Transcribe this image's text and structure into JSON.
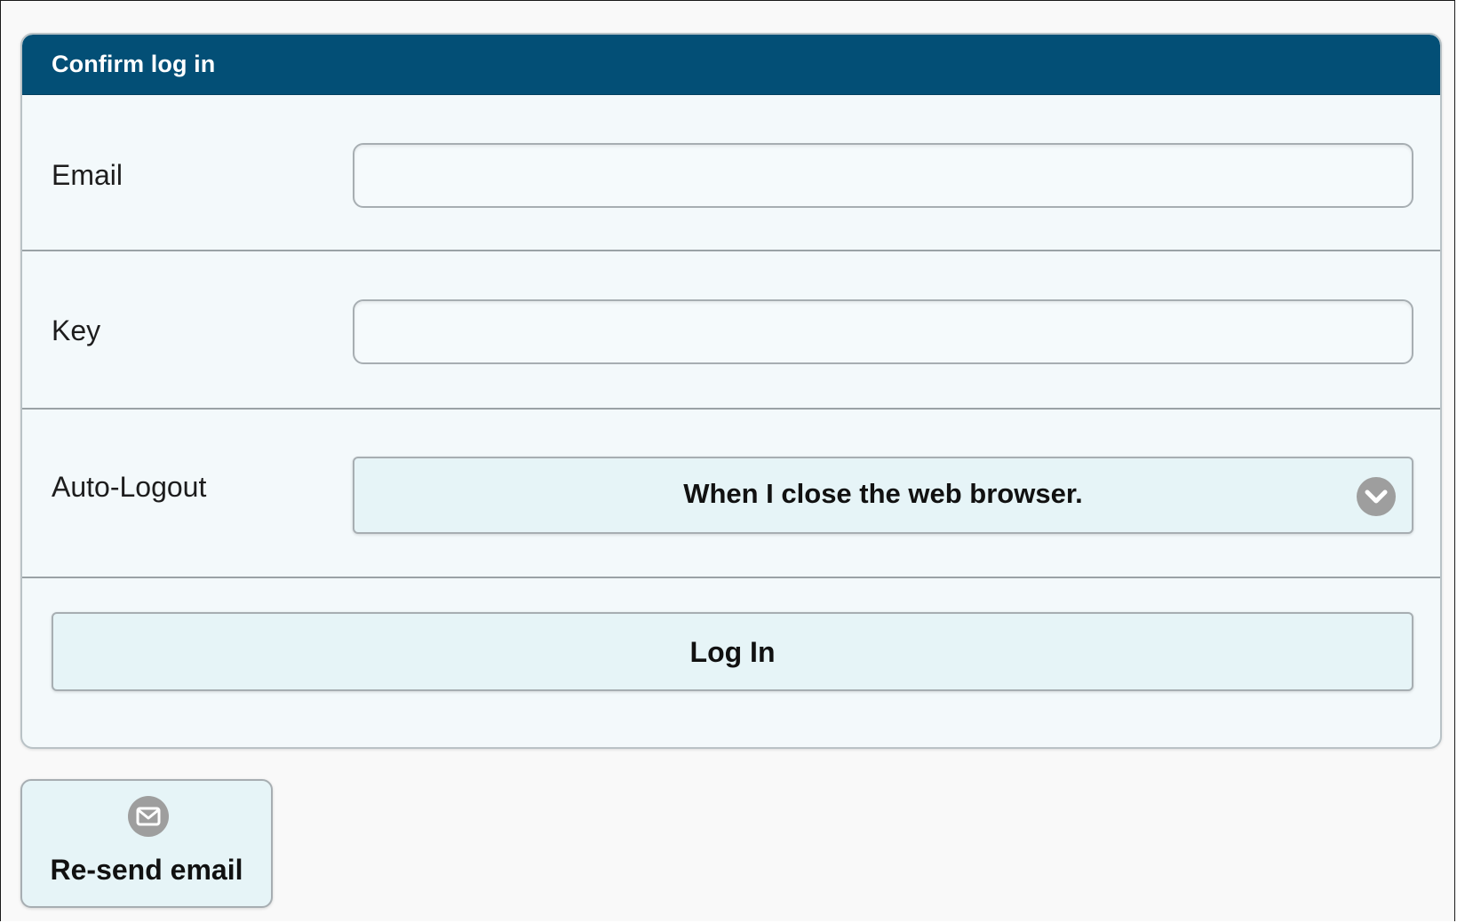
{
  "panel": {
    "title": "Confirm log in"
  },
  "form": {
    "email": {
      "label": "Email",
      "value": "",
      "placeholder": ""
    },
    "key": {
      "label": "Key",
      "value": "",
      "placeholder": ""
    },
    "auto_logout": {
      "label": "Auto-Logout",
      "selected": "When I close the web browser."
    },
    "login_label": "Log In"
  },
  "resend": {
    "label": "Re-send email",
    "icon": "mail-icon"
  },
  "colors": {
    "header": "#034f76",
    "button_bg": "#e6f4f7",
    "panel_bg": "#f3f9fb",
    "icon_gray": "#9e9e9e"
  }
}
